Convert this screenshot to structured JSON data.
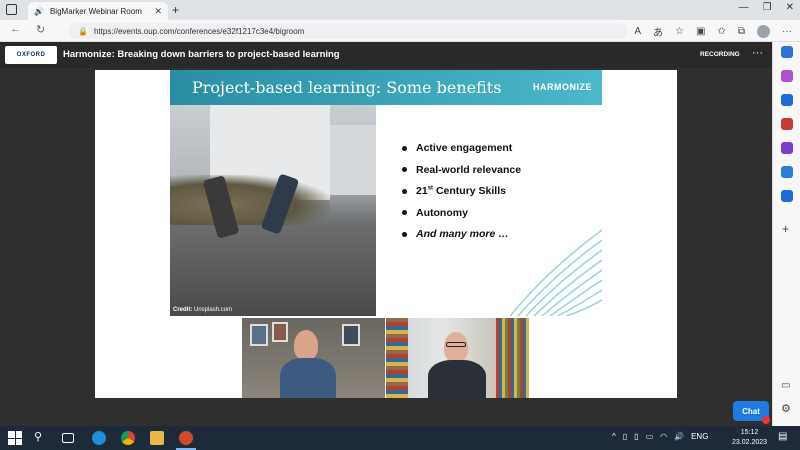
{
  "browser": {
    "tab_title": "BigMarker Webinar Room",
    "url": "https://events.oup.com/conferences/e32f1217c3e4/bigroom"
  },
  "header": {
    "logo_text": "OXFORD",
    "title": "Harmonize: Breaking down barriers to project-based learning",
    "recording_label": "RECORDING",
    "more_label": "···"
  },
  "slide": {
    "title": "Project-based learning: Some benefits",
    "brand": "HARMONIZE",
    "credit_label": "Credit:",
    "credit_source": "Unsplash.com",
    "bullets": [
      {
        "text": "Active engagement"
      },
      {
        "text": "Real-world relevance"
      },
      {
        "text_pre": "21",
        "sup": "st",
        "text_post": " Century Skills"
      },
      {
        "text": "Autonomy"
      },
      {
        "text": "And many more …"
      }
    ]
  },
  "chat": {
    "label": "Chat"
  },
  "taskbar": {
    "language": "ENG",
    "time": "15:12",
    "date": "23.02.2023"
  },
  "colors": {
    "banner": "#2a8ea3",
    "chat_button": "#1e7be0",
    "taskbar": "#1c2a3a"
  }
}
